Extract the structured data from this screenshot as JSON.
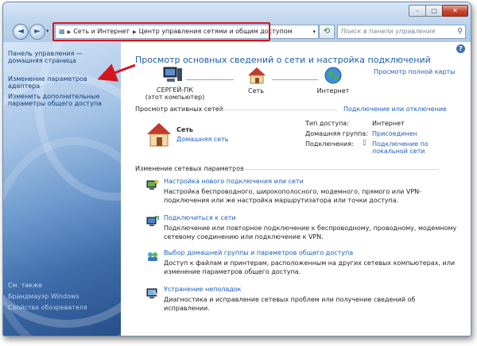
{
  "window": {
    "controls": {
      "minimize": "–",
      "maximize": "□",
      "close": "✕"
    }
  },
  "navbar": {
    "back_icon": "◄",
    "forward_icon": "►",
    "dropdown_icon": "▾",
    "address_segments": [
      "Сеть и Интернет",
      "Центр управления сетями и общим доступом"
    ],
    "address_dropdown": "▾",
    "refresh_icon": "⟲",
    "search_placeholder": "Поиск в панели управления",
    "search_icon": "⚲"
  },
  "sidebar": {
    "items": [
      {
        "label": "Панель управления — домашняя страница"
      },
      {
        "label": "Изменение параметров адаптера"
      },
      {
        "label": "Изменить дополнительные параметры общего доступа"
      }
    ],
    "bottom_items": [
      "См. также",
      "Брандмауэр Windows",
      "Свойства обозревателя"
    ]
  },
  "main": {
    "help_icon": "?",
    "title": "Просмотр основных сведений о сети и настройка подключений",
    "full_map_link": "Просмотр полной карты",
    "map": {
      "computer_name": "СЕРГЕЙ-ПК",
      "computer_sub": "(этот компьютер)",
      "network_label": "Сеть",
      "internet_label": "Интернет"
    },
    "active_networks": {
      "section_label": "Просмотр активных сетей",
      "connect_link": "Подключение или отключение",
      "network_name": "Сеть",
      "network_type": "Домашняя сеть",
      "access_type_key": "Тип доступа:",
      "access_type_value": "Интернет",
      "homegroup_key": "Домашняя группа:",
      "homegroup_value": "Присоединен",
      "connections_key": "Подключения:",
      "connections_value": "Подключение по локальной сети"
    },
    "change_settings": {
      "section_label": "Изменение сетевых параметров",
      "tasks": [
        {
          "link": "Настройка нового подключения или сети",
          "desc": "Настройка беспроводного, широкополосного, модемного, прямого или VPN-подключения или же настройка маршрутизатора или точки доступа."
        },
        {
          "link": "Подключиться к сети",
          "desc": "Подключение или повторное подключение к беспроводному, проводному, модемному сетевому соединению или подключение к VPN."
        },
        {
          "link": "Выбор домашней группы и параметров общего доступа",
          "desc": "Доступ к файлам и принтерам, расположенным на других сетевых компьютерах, или изменение параметров общего доступа."
        },
        {
          "link": "Устранение неполадок",
          "desc": "Диагностика и исправление сетевых проблем или получение сведений об исправлении."
        }
      ]
    }
  },
  "colors": {
    "link": "#1a5bbd",
    "title": "#1e5ca8",
    "annotation_red": "#d4151d"
  }
}
